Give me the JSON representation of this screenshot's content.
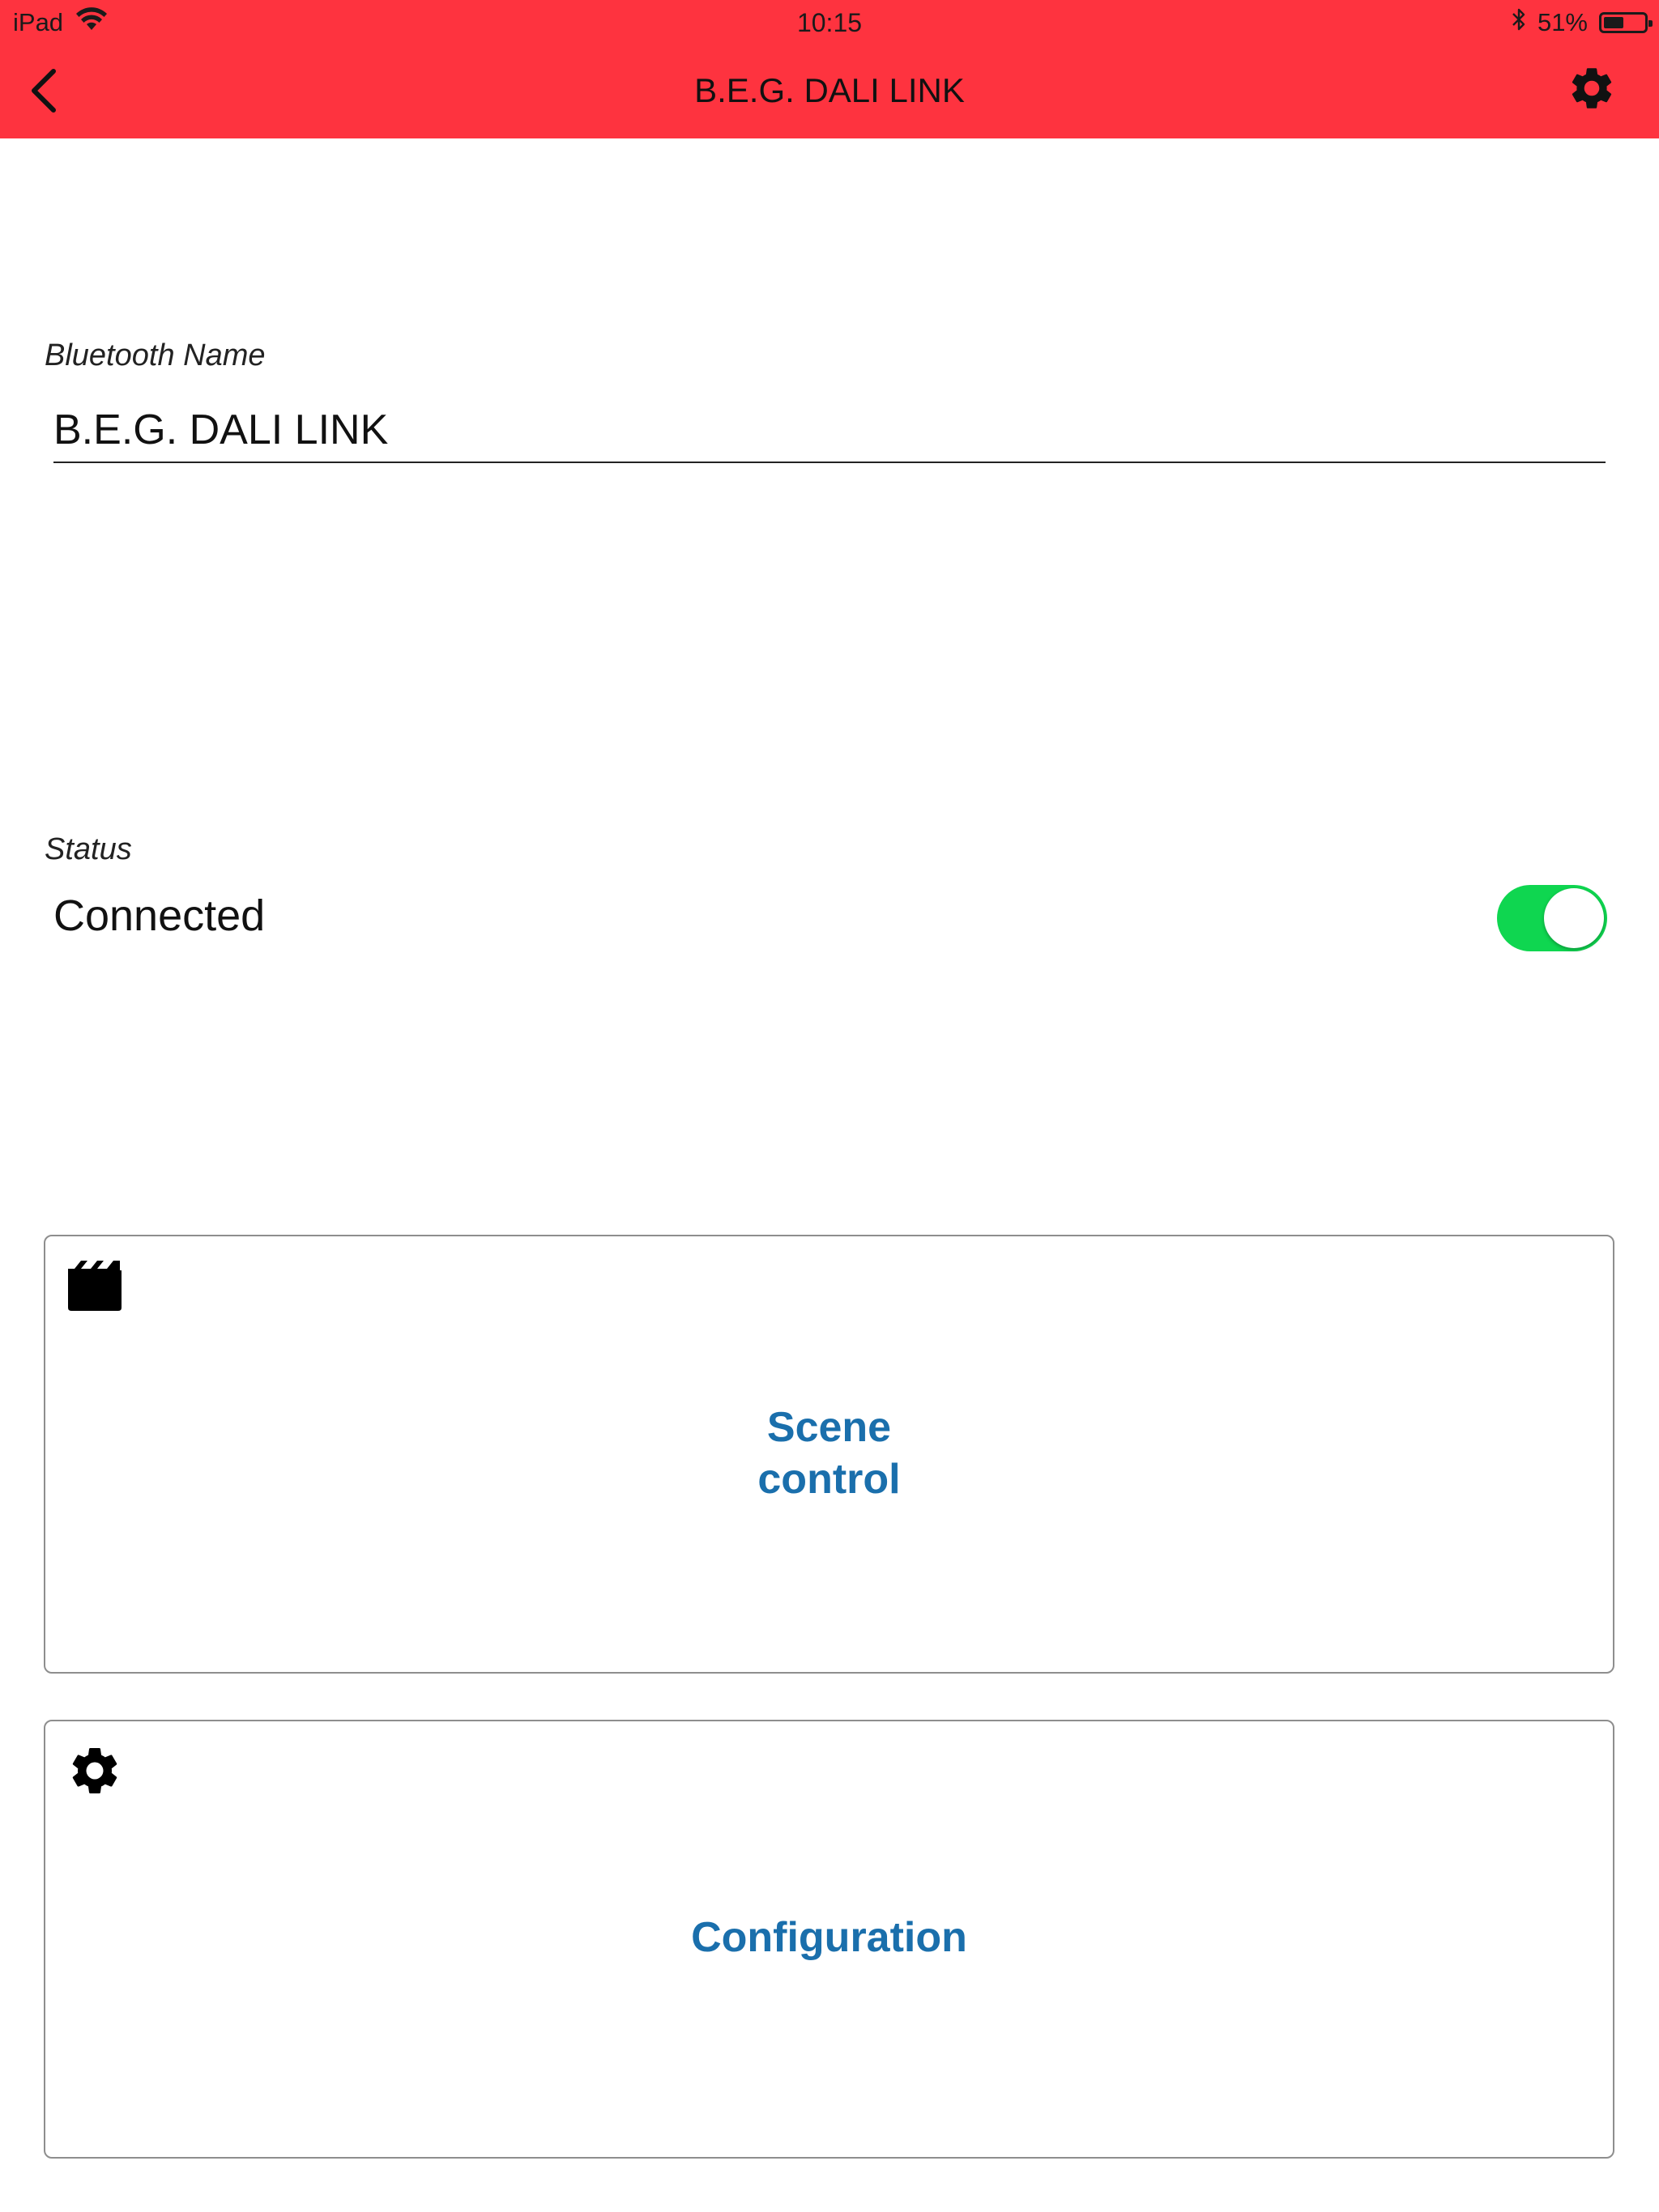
{
  "status_bar": {
    "device": "iPad",
    "time": "10:15",
    "battery_percent": "51%",
    "battery_level": 0.51,
    "icons": [
      "wifi-icon",
      "bluetooth-icon",
      "battery-icon"
    ]
  },
  "nav": {
    "title": "B.E.G. DALI LINK",
    "back_icon": "chevron-left-icon",
    "settings_icon": "gear-icon"
  },
  "bluetooth": {
    "label": "Bluetooth Name",
    "value": "B.E.G. DALI LINK"
  },
  "status": {
    "label": "Status",
    "value": "Connected",
    "toggle_on": true
  },
  "tiles": [
    {
      "label_line1": "Scene",
      "label_line2": "control",
      "icon": "clapperboard-icon"
    },
    {
      "label": "Configuration",
      "icon": "gear-icon"
    }
  ],
  "colors": {
    "header": "#fe333f",
    "toggle_on": "#0fd650",
    "tile_text": "#1a6fac"
  }
}
